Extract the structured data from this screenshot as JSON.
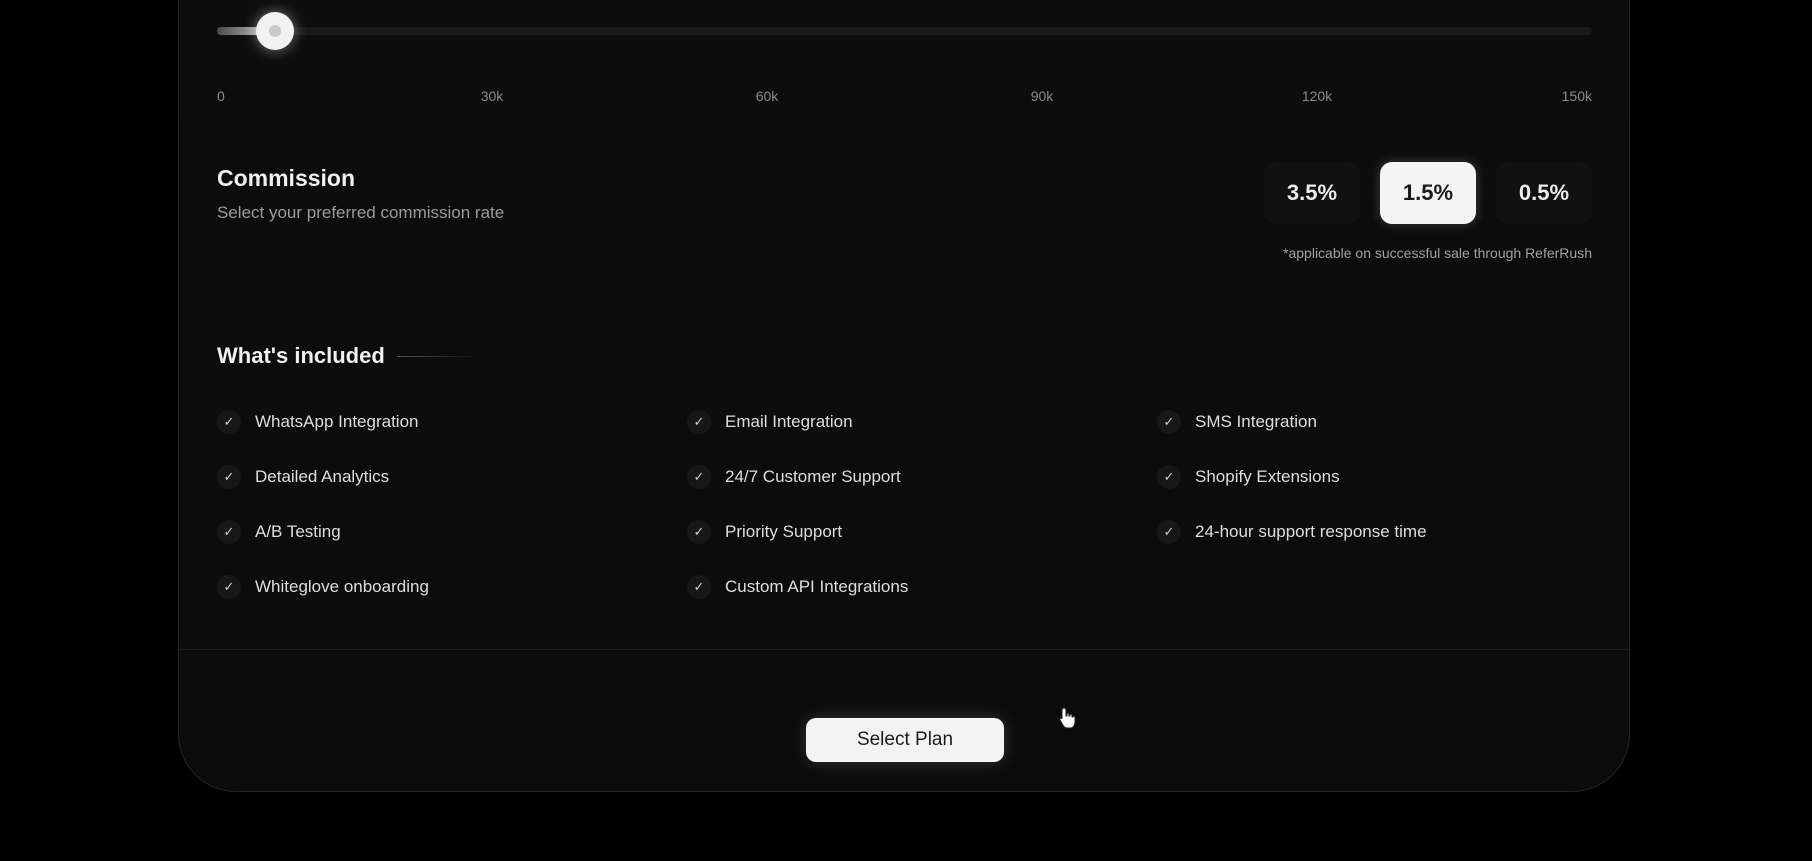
{
  "slider": {
    "value_fraction": 0.042,
    "ticks": [
      "0",
      "30k",
      "60k",
      "90k",
      "120k",
      "150k"
    ]
  },
  "commission": {
    "title": "Commission",
    "subtitle": "Select your preferred commission rate",
    "options": [
      "3.5%",
      "1.5%",
      "0.5%"
    ],
    "selected": "1.5%",
    "note": "*applicable on successful sale through ReferRush"
  },
  "included": {
    "title": "What's included",
    "features": [
      "WhatsApp Integration",
      "Email Integration",
      "SMS Integration",
      "Detailed Analytics",
      "24/7 Customer Support",
      "Shopify Extensions",
      "A/B Testing",
      "Priority Support",
      "24-hour support response time",
      "Whiteglove onboarding",
      "Custom API Integrations"
    ],
    "check_icon": "check-icon"
  },
  "cta": {
    "label": "Select Plan"
  },
  "colors": {
    "background": "#000000",
    "card": "#0c0c0c",
    "accent": "#f3f3f3"
  }
}
